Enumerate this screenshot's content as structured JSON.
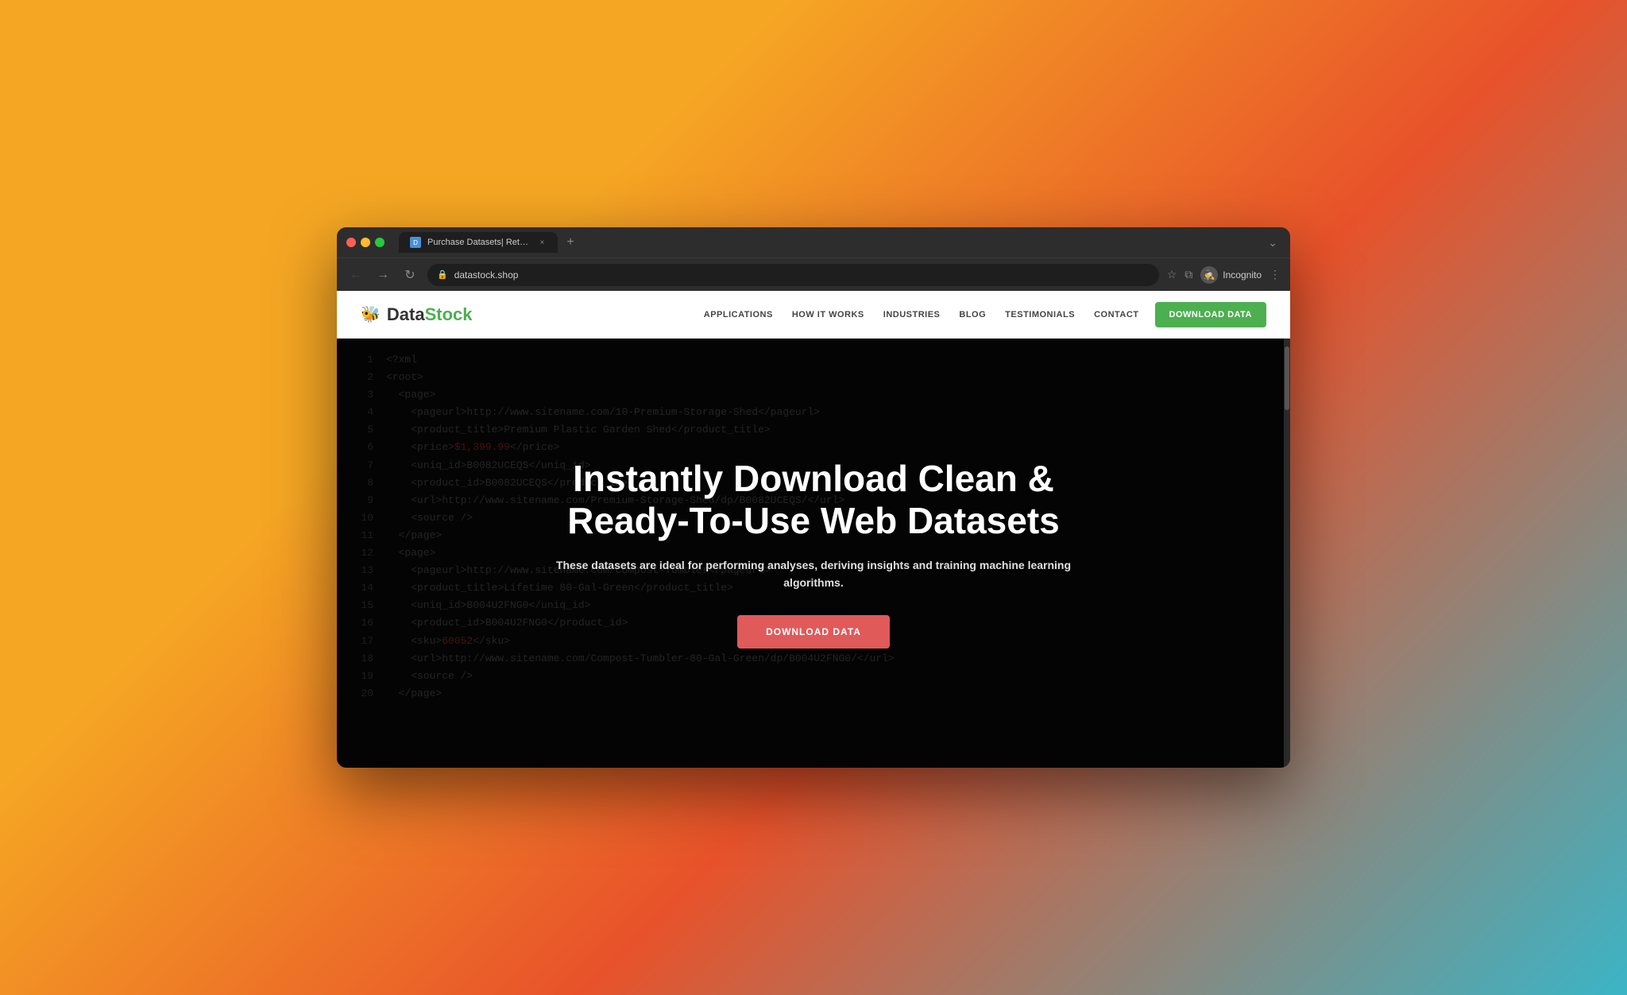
{
  "browser": {
    "tab_title": "Purchase Datasets| Retail Data...",
    "tab_favicon": "D",
    "url": "datastock.shop",
    "add_tab_label": "+",
    "chevron_label": "⌄",
    "back_label": "←",
    "forward_label": "→",
    "reload_label": "↻",
    "star_label": "☆",
    "tab_label": "⊞",
    "incognito_label": "Incognito",
    "more_label": "⋮"
  },
  "navbar": {
    "logo_text_data": "Data",
    "logo_text_stock": "Stock",
    "nav_items": [
      {
        "label": "APPLICATIONS"
      },
      {
        "label": "HOW IT WORKS"
      },
      {
        "label": "INDUSTRIES"
      },
      {
        "label": "BLOG"
      },
      {
        "label": "TESTIMONIALS"
      },
      {
        "label": "CONTACT"
      }
    ],
    "download_btn": "DOWNLOAD DATA"
  },
  "hero": {
    "title": "Instantly Download Clean & Ready-To-Use Web Datasets",
    "subtitle": "These datasets are ideal for performing analyses, deriving insights and training machine learning algorithms.",
    "download_btn": "DOWNLOAD DATA"
  },
  "code_lines": [
    {
      "num": "1",
      "text": "<?xml"
    },
    {
      "num": "2",
      "text": "<root>"
    },
    {
      "num": "3",
      "text": "  <page>"
    },
    {
      "num": "4",
      "text": "    <pageurl>http://www.sitename.com/10-Premium-Storage-Shed</pageurl>"
    },
    {
      "num": "5",
      "text": "    <product_title>Premium Plastic Garden Shed</product_title>"
    },
    {
      "num": "6",
      "text": "    <price>$1,399.99</price>"
    },
    {
      "num": "7",
      "text": "    <uniq_id>B0082UCEQS</uniq_id>"
    },
    {
      "num": "8",
      "text": "    <product_id>B0082UCEQS</product_id>"
    },
    {
      "num": "9",
      "text": "    <url>http://www.sitename.com/Premium-Storage-Shed/dp/B0082UCEQS/</url>"
    },
    {
      "num": "10",
      "text": "    <source />"
    },
    {
      "num": "11",
      "text": "  </page>"
    },
    {
      "num": "12",
      "text": "  <page>"
    },
    {
      "num": "13",
      "text": "    <pageurl>http://www.sitename.com/Compost-Tumbler</pageurl>"
    },
    {
      "num": "14",
      "text": "    <product_title>Lifetime 80-Gal-Green</product_title>"
    },
    {
      "num": "15",
      "text": "    <uniq_id>B004U2FNG0</uniq_id>"
    },
    {
      "num": "16",
      "text": "    <product_id>B004U2FNG0</product_id>"
    },
    {
      "num": "17",
      "text": "    <sku>60052</sku>"
    },
    {
      "num": "18",
      "text": "    <url>http://www.sitename.com/Compost-Tumbler-80-Gal-Green/dp/B004U2FNG0/</url>"
    },
    {
      "num": "19",
      "text": "    <source />"
    },
    {
      "num": "20",
      "text": "  </page>"
    }
  ],
  "colors": {
    "green": "#4caf50",
    "red_btn": "#e05a5a",
    "code_bg": "#0d0d0d",
    "nav_bg": "#ffffff"
  }
}
